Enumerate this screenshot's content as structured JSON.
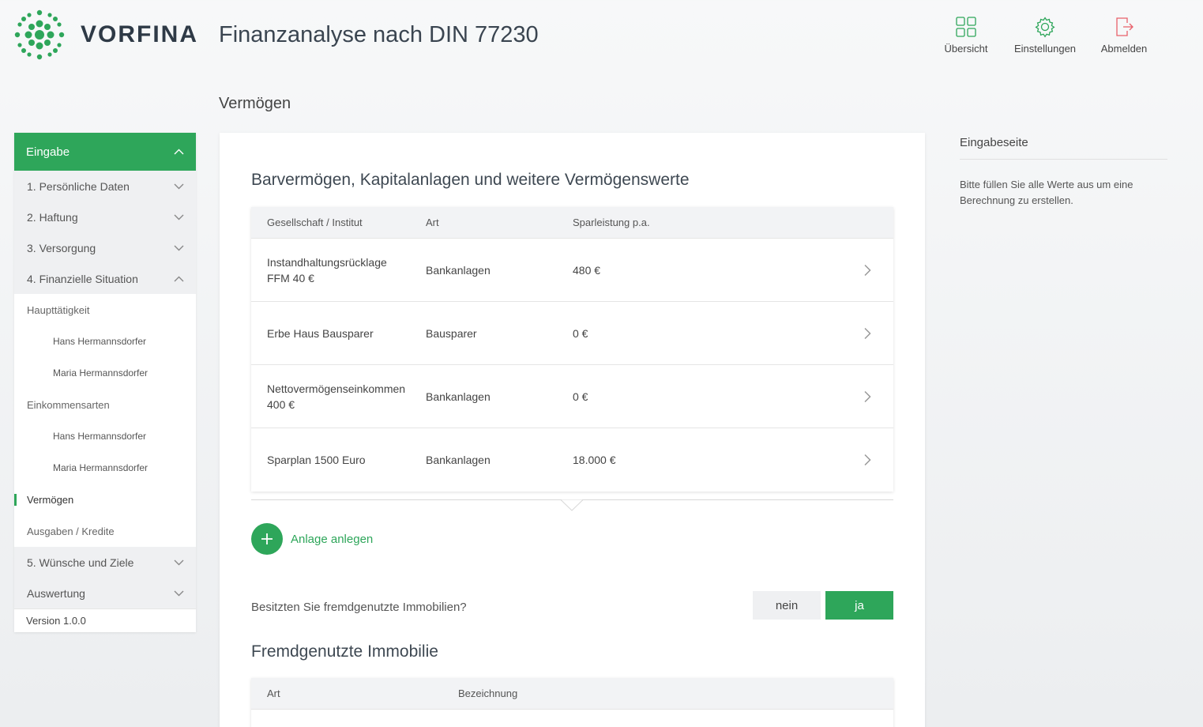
{
  "brand": {
    "name": "VORFINA",
    "accent": "#2ea65a"
  },
  "app_title": "Finanzanalyse nach DIN 77230",
  "top_actions": [
    {
      "label": "Übersicht",
      "icon": "grid-icon"
    },
    {
      "label": "Einstellungen",
      "icon": "gear-icon"
    },
    {
      "label": "Abmelden",
      "icon": "logout-icon"
    }
  ],
  "page_heading": "Vermögen",
  "sidebar": {
    "header": "Eingabe",
    "items": [
      {
        "label": "1. Persönliche Daten"
      },
      {
        "label": "2. Haftung"
      },
      {
        "label": "3. Versorgung"
      },
      {
        "label": "4. Finanzielle Situation"
      }
    ],
    "subitems": [
      {
        "label": "Haupttätigkeit"
      },
      {
        "label": "Hans Hermannsdorfer"
      },
      {
        "label": "Maria Hermannsdorfer"
      },
      {
        "label": "Einkommensarten"
      },
      {
        "label": "Hans Hermannsdorfer"
      },
      {
        "label": "Maria Hermannsdorfer"
      },
      {
        "label": "Vermögen"
      },
      {
        "label": "Ausgaben / Kredite"
      }
    ],
    "items_after": [
      {
        "label": "5. Wünsche und Ziele"
      },
      {
        "label": "Auswertung"
      }
    ],
    "version": "Version 1.0.0"
  },
  "main": {
    "section_title": "Barvermögen, Kapitalanlagen und weitere Vermögenswerte",
    "table": {
      "headers": [
        "Gesellschaft / Institut",
        "Art",
        "Sparleistung p.a."
      ],
      "rows": [
        {
          "name_line1": "Instandhaltungsrücklage",
          "name_line2": "FFM 40 €",
          "art": "Bankanlagen",
          "amount": "480 €"
        },
        {
          "name_line1": "Erbe Haus Bausparer",
          "name_line2": "",
          "art": "Bausparer",
          "amount": "0 €"
        },
        {
          "name_line1": "Nettovermögenseinkommen",
          "name_line2": "400 €",
          "art": "Bankanlagen",
          "amount": "0 €"
        },
        {
          "name_line1": "Sparplan 1500 Euro",
          "name_line2": "",
          "art": "Bankanlagen",
          "amount": "18.000 €"
        }
      ]
    },
    "add_label": "Anlage anlegen",
    "question": "Besitzten Sie fremdgenutzte Immobilien?",
    "toggle": {
      "no": "nein",
      "yes": "ja",
      "selected": "ja"
    },
    "section2_title": "Fremdgenutzte Immobilie",
    "table2_headers": [
      "Art",
      "Bezeichnung"
    ]
  },
  "info_panel": {
    "title": "Eingabeseite",
    "text": "Bitte füllen Sie alle Werte aus um eine Berechnung zu erstellen."
  }
}
